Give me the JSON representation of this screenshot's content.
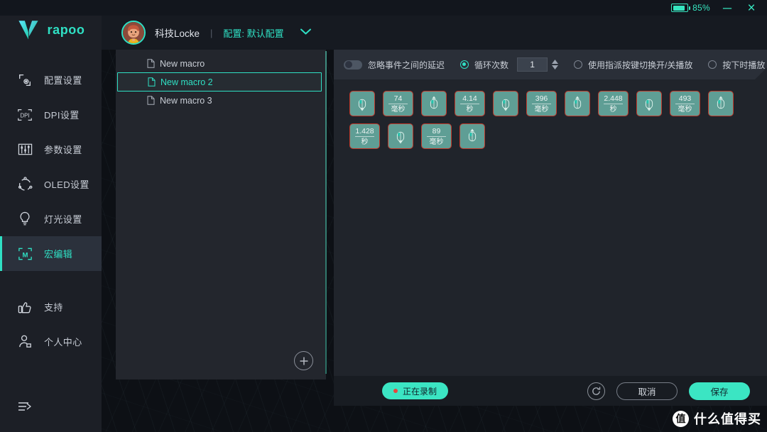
{
  "titlebar": {
    "battery_percent": "85%",
    "battery_level": 85,
    "minimize_label": "─",
    "close_label": "×"
  },
  "brand": {
    "name": "rapoo",
    "logo": "rapoo-v-logo"
  },
  "sidebar": {
    "items": [
      {
        "label": "配置设置",
        "icon": "profile-settings-icon",
        "active": false
      },
      {
        "label": "DPI设置",
        "icon": "dpi-icon",
        "active": false
      },
      {
        "label": "参数设置",
        "icon": "sliders-icon",
        "active": false
      },
      {
        "label": "OLED设置",
        "icon": "oled-icon",
        "active": false
      },
      {
        "label": "灯光设置",
        "icon": "lightbulb-icon",
        "active": false
      },
      {
        "label": "宏编辑",
        "icon": "macro-icon",
        "active": true
      },
      {
        "label": "支持",
        "icon": "thumbs-up-icon",
        "active": false
      },
      {
        "label": "个人中心",
        "icon": "user-icon",
        "active": false
      }
    ],
    "collapse": {
      "label": "",
      "icon": "collapse-menu-icon"
    }
  },
  "header": {
    "user_name": "科技Locke",
    "separator": "|",
    "config_label": "配置: 默认配置",
    "dropdown_icon": "chevron-down-icon",
    "avatar": "user-avatar"
  },
  "macro_list": {
    "items": [
      {
        "name": "New macro",
        "selected": false
      },
      {
        "name": "New macro 2",
        "selected": true
      },
      {
        "name": "New macro 3",
        "selected": false
      }
    ],
    "add_label": "+"
  },
  "options": {
    "ignore_delay": {
      "label": "忽略事件之间的延迟",
      "on": false
    },
    "loop_count": {
      "label": "循环次数",
      "selected": true,
      "value": "1"
    },
    "toggle_key": {
      "label": "使用指派按键切换开/关播放",
      "selected": false
    },
    "play_on_press": {
      "label": "按下时播放",
      "selected": false
    }
  },
  "events": [
    {
      "type": "mouse-down",
      "icon": "mouse-button-down-icon"
    },
    {
      "type": "delay",
      "value": "74",
      "unit": "毫秒"
    },
    {
      "type": "mouse-up",
      "icon": "mouse-button-up-icon"
    },
    {
      "type": "delay",
      "value": "4.14",
      "unit": "秒"
    },
    {
      "type": "mouse-down",
      "icon": "mouse-button-down-icon"
    },
    {
      "type": "delay",
      "value": "396",
      "unit": "毫秒"
    },
    {
      "type": "mouse-up",
      "icon": "mouse-button-up-icon"
    },
    {
      "type": "delay",
      "value": "2.448",
      "unit": "秒"
    },
    {
      "type": "mouse-down",
      "icon": "mouse-button-down-icon"
    },
    {
      "type": "delay",
      "value": "493",
      "unit": "毫秒"
    },
    {
      "type": "mouse-up",
      "icon": "mouse-button-up-icon"
    },
    {
      "type": "delay",
      "value": "1.428",
      "unit": "秒"
    },
    {
      "type": "mouse-down",
      "icon": "mouse-button-down-icon"
    },
    {
      "type": "delay",
      "value": "89",
      "unit": "毫秒"
    },
    {
      "type": "mouse-up",
      "icon": "mouse-button-up-icon"
    }
  ],
  "bottom": {
    "record_label": "正在录制",
    "reset_icon": "refresh-icon",
    "cancel_label": "取消",
    "save_label": "保存"
  },
  "watermark": {
    "badge": "值",
    "text": "什么值得买"
  },
  "colors": {
    "accent": "#2fe0c4",
    "accent_solid": "#3be5c3",
    "card_bg": "#5f9e95",
    "card_border": "#c0392b",
    "rail_bg": "#1c1f26",
    "panel_bg": "#23262d",
    "editor_bg": "#20242b",
    "rec_dot": "#e8453c"
  }
}
